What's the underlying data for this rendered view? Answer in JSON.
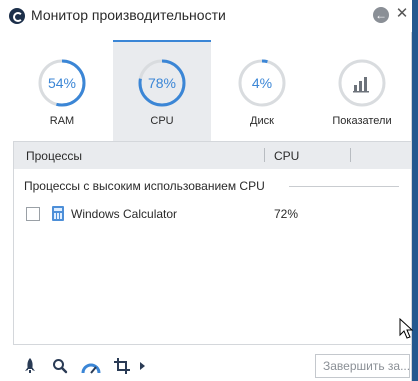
{
  "window": {
    "title": "Монитор производительности",
    "back_icon": "back-arrow-icon",
    "close_symbol": "✕"
  },
  "tabs": [
    {
      "value": "54%",
      "label": "RAM",
      "level": 0.54,
      "active": false
    },
    {
      "value": "78%",
      "label": "CPU",
      "level": 0.78,
      "active": true
    },
    {
      "value": "4%",
      "label": "Диск",
      "level": 0.04,
      "active": false
    },
    {
      "value": "",
      "label": "Показатели",
      "active": false,
      "icon": "bar-chart-icon"
    }
  ],
  "table": {
    "columns": [
      "Процессы",
      "CPU"
    ],
    "section_title": "Процессы с высоким использованием CPU",
    "rows": [
      {
        "name": "Windows Calculator",
        "cpu": "72%",
        "checked": false,
        "icon": "calculator-icon"
      }
    ]
  },
  "toolbar": {
    "icons": [
      "rocket-icon",
      "search-icon",
      "speedometer-icon",
      "crop-icon"
    ],
    "end_task_label": "Завершить за..."
  },
  "colors": {
    "accent": "#3b86d6",
    "gauge_track": "#d9dcdf",
    "header_bg": "#e9ebee"
  }
}
